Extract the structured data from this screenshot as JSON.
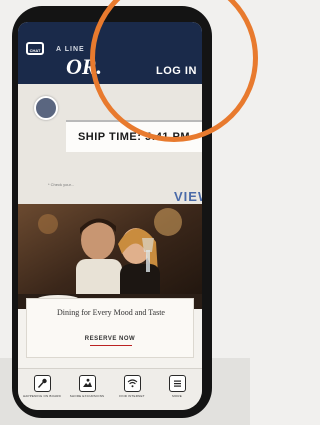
{
  "header": {
    "brand_sub": "A LINE",
    "brand_main": "OR.",
    "login_label": "LOG IN",
    "chat_icon_text": "CHAT"
  },
  "info": {
    "ship_time": "SHIP TIME: 5:41 PM",
    "checkpoint_text": "* Check your...",
    "view_label": "VIEW"
  },
  "promo": {
    "title": "Dining for Every Mood and Taste",
    "cta_label": "RESERVE NOW"
  },
  "tabs": [
    {
      "label": "HAPPENING ON BOARD",
      "icon": "microphone-icon"
    },
    {
      "label": "SHORE EXCURSIONS",
      "icon": "excursion-icon"
    },
    {
      "label": "FIND INTERNET",
      "icon": "wifi-icon"
    },
    {
      "label": "MORE",
      "icon": "menu-icon"
    }
  ],
  "colors": {
    "navbar": "#1a2a4a",
    "accent_ring": "#e87a2e",
    "view_link": "#4a6aa8",
    "cta_underline": "#bb2222"
  }
}
